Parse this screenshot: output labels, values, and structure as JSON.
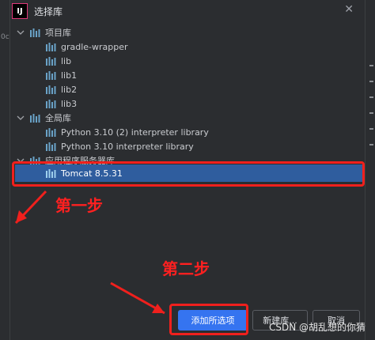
{
  "dialog": {
    "title": "选择库",
    "close": "✕"
  },
  "tree": {
    "groups": [
      {
        "label": "项目库",
        "items": [
          "gradle-wrapper",
          "lib",
          "lib1",
          "lib2",
          "lib3"
        ]
      },
      {
        "label": "全局库",
        "items": [
          "Python 3.10 (2) interpreter library",
          "Python 3.10 interpreter library"
        ]
      },
      {
        "label": "应用程序服务器库",
        "items": [
          "Tomcat 8.5.31"
        ]
      }
    ],
    "selected": "Tomcat 8.5.31"
  },
  "annotations": {
    "step1": "第一步",
    "step2": "第二步"
  },
  "buttons": {
    "add_selected": "添加所选项",
    "new_library": "新建库...",
    "cancel": "取消"
  },
  "watermark": "CSDN @胡乱想的你猜",
  "background": {
    "left_text": "0c"
  },
  "colors": {
    "dialog_bg": "#2b2d30",
    "selection": "#2f5d9e",
    "primary_button": "#3574f0",
    "annotation_red": "#f0201d",
    "library_icon": "#6aa3c8"
  }
}
